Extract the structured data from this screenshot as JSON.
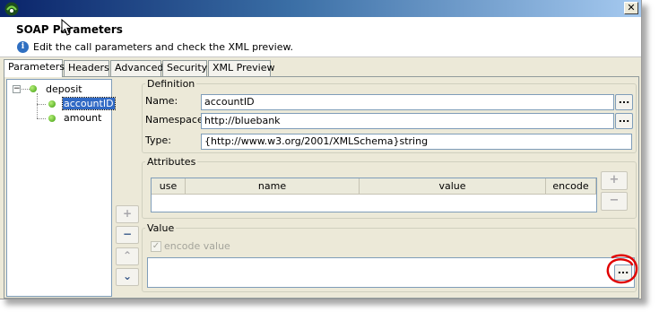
{
  "window": {
    "title": "",
    "close_glyph": "✕"
  },
  "header": {
    "title": "SOAP Parameters",
    "description": "Edit the call parameters and check the XML preview.",
    "info_glyph": "i"
  },
  "tabs": [
    {
      "label": "Parameters",
      "active": true
    },
    {
      "label": "Headers",
      "active": false
    },
    {
      "label": "Advanced",
      "active": false
    },
    {
      "label": "Security",
      "active": false
    },
    {
      "label": "XML Preview",
      "active": false
    }
  ],
  "tree": {
    "toggle_glyph": "−",
    "root": {
      "label": "deposit",
      "icon": "green-dot-icon"
    },
    "children": [
      {
        "label": "accountID",
        "selected": true,
        "icon": "green-dot-icon"
      },
      {
        "label": "amount",
        "selected": false,
        "icon": "green-dot-icon"
      }
    ]
  },
  "side_buttons": {
    "add": "+",
    "remove": "−",
    "move_up": "⌃",
    "move_down": "⌄"
  },
  "definition": {
    "legend": "Definition",
    "name_label": "Name:",
    "name_value": "accountID",
    "namespace_label": "Namespace:",
    "namespace_value": "http://bluebank",
    "type_label": "Type:",
    "type_value": "{http://www.w3.org/2001/XMLSchema}string",
    "browse_label": "..."
  },
  "attributes": {
    "legend": "Attributes",
    "columns": [
      "use",
      "name",
      "value",
      "encode"
    ],
    "rows": [],
    "add_label": "+",
    "remove_label": "−"
  },
  "value": {
    "legend": "Value",
    "encode_label": "encode value",
    "encode_checked": true,
    "encode_enabled": false,
    "text": "",
    "browse_label": "..."
  },
  "colors": {
    "title_gradient_start": "#0a246a",
    "title_gradient_end": "#a6caf0",
    "panel_bg": "#ece9d8",
    "selection": "#316ac5",
    "annotation": "#e00000"
  }
}
